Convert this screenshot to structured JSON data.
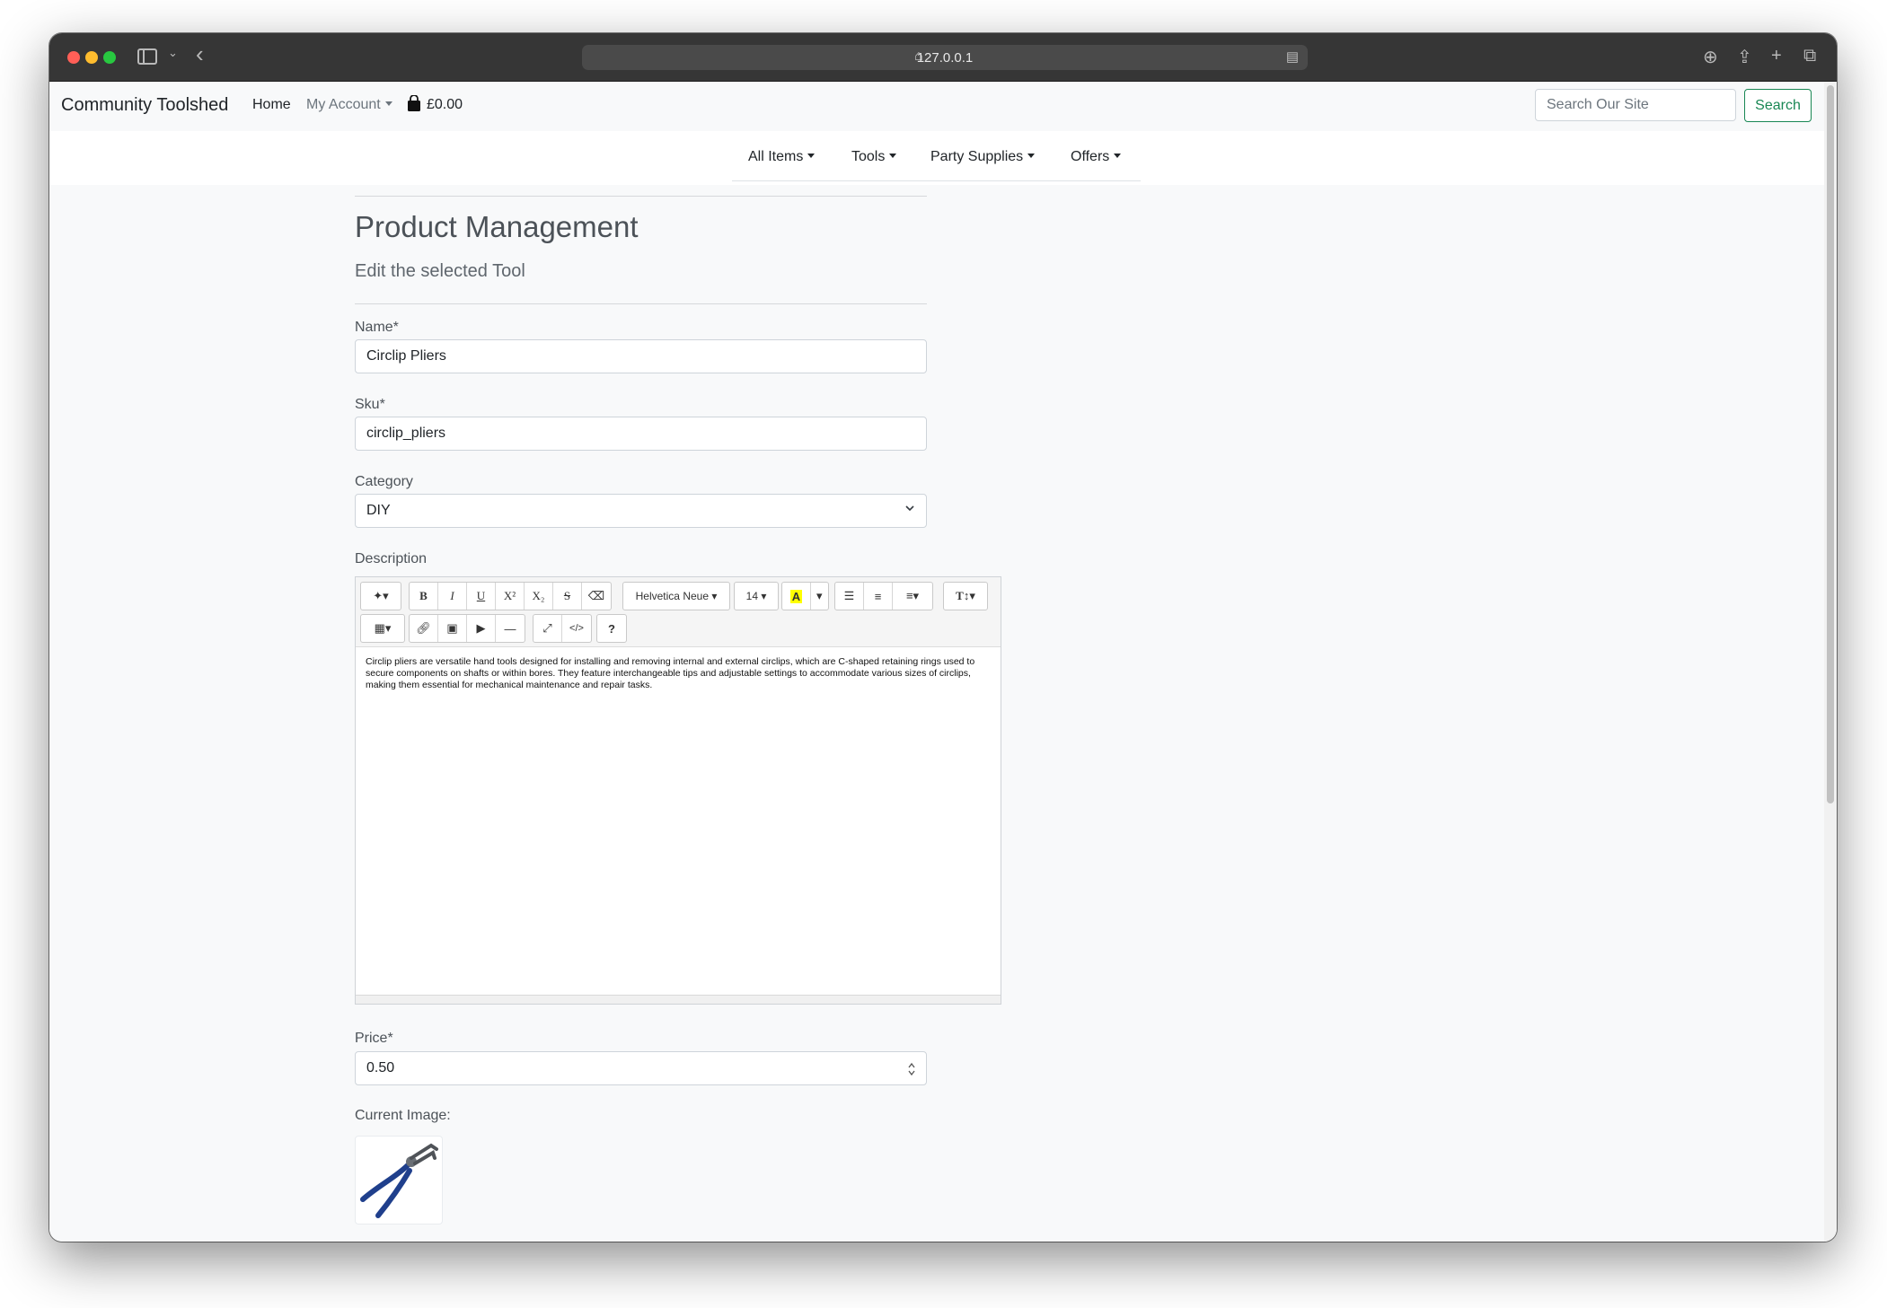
{
  "browser": {
    "url": "127.0.0.1"
  },
  "nav": {
    "brand": "Community Toolshed",
    "home": "Home",
    "account": "My Account",
    "basket_total": "£0.00",
    "search_placeholder": "Search Our Site",
    "search_button": "Search"
  },
  "categories": [
    "All Items",
    "Tools",
    "Party Supplies",
    "Offers"
  ],
  "page": {
    "title": "Product Management",
    "subtitle": "Edit the selected Tool"
  },
  "form": {
    "name_label": "Name*",
    "name_value": "Circlip Pliers",
    "sku_label": "Sku*",
    "sku_value": "circlip_pliers",
    "category_label": "Category",
    "category_value": "DIY",
    "description_label": "Description",
    "description_text": "Circlip pliers are versatile hand tools designed for installing and removing internal and external circlips, which are C-shaped retaining rings used to secure components on shafts or within bores. They feature interchangeable tips and adjustable settings to accommodate various sizes of circlips, making them essential for mechanical maintenance and repair tasks.",
    "price_label": "Price*",
    "price_value": "0.50",
    "current_image_label": "Current Image:"
  },
  "editor": {
    "font_name": "Helvetica Neue",
    "font_size": "14",
    "highlight_color": "#ffff00"
  },
  "colors": {
    "accent": "#198754"
  }
}
